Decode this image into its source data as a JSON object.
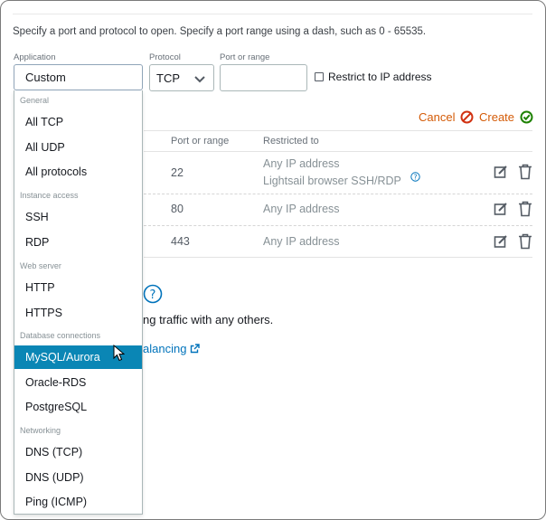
{
  "intro_text": "Specify a port and protocol to open. Specify a port range using a dash, such as 0 - 65535.",
  "form": {
    "application_label": "Application",
    "application_value": "Custom",
    "protocol_label": "Protocol",
    "protocol_value": "TCP",
    "port_label": "Port or range",
    "port_value": "",
    "restrict_label": "Restrict to IP address",
    "restrict_checked": false
  },
  "actions": {
    "cancel": "Cancel",
    "create": "Create"
  },
  "table": {
    "col_truncated": "l",
    "headers": {
      "port": "Port or range",
      "restricted": "Restricted to"
    },
    "rows": [
      {
        "port": "22",
        "restricted": "Any IP address",
        "restricted_extra": "Lightsail browser SSH/RDP"
      },
      {
        "port": "80",
        "restricted": "Any IP address"
      },
      {
        "port": "443",
        "restricted": "Any IP address"
      }
    ]
  },
  "background_fragments": {
    "help": "?",
    "traffic_text": "ng traffic with any others.",
    "link_text": "alancing"
  },
  "dropdown": {
    "groups": {
      "general": "General",
      "instance_access": "Instance access",
      "web_server": "Web server",
      "database": "Database connections",
      "networking": "Networking"
    },
    "items": {
      "all_tcp": "All TCP",
      "all_udp": "All UDP",
      "all_protocols": "All protocols",
      "ssh": "SSH",
      "rdp": "RDP",
      "http": "HTTP",
      "https": "HTTPS",
      "mysql": "MySQL/Aurora",
      "oracle": "Oracle-RDS",
      "postgres": "PostgreSQL",
      "dns_tcp": "DNS (TCP)",
      "dns_udp": "DNS (UDP)",
      "ping": "Ping (ICMP)"
    },
    "highlighted": "MySQL/Aurora"
  },
  "colors": {
    "accent_orange": "#d45b07",
    "link_blue": "#0073bb",
    "highlight_blue": "#0a86b5",
    "success_green": "#1d8102"
  }
}
